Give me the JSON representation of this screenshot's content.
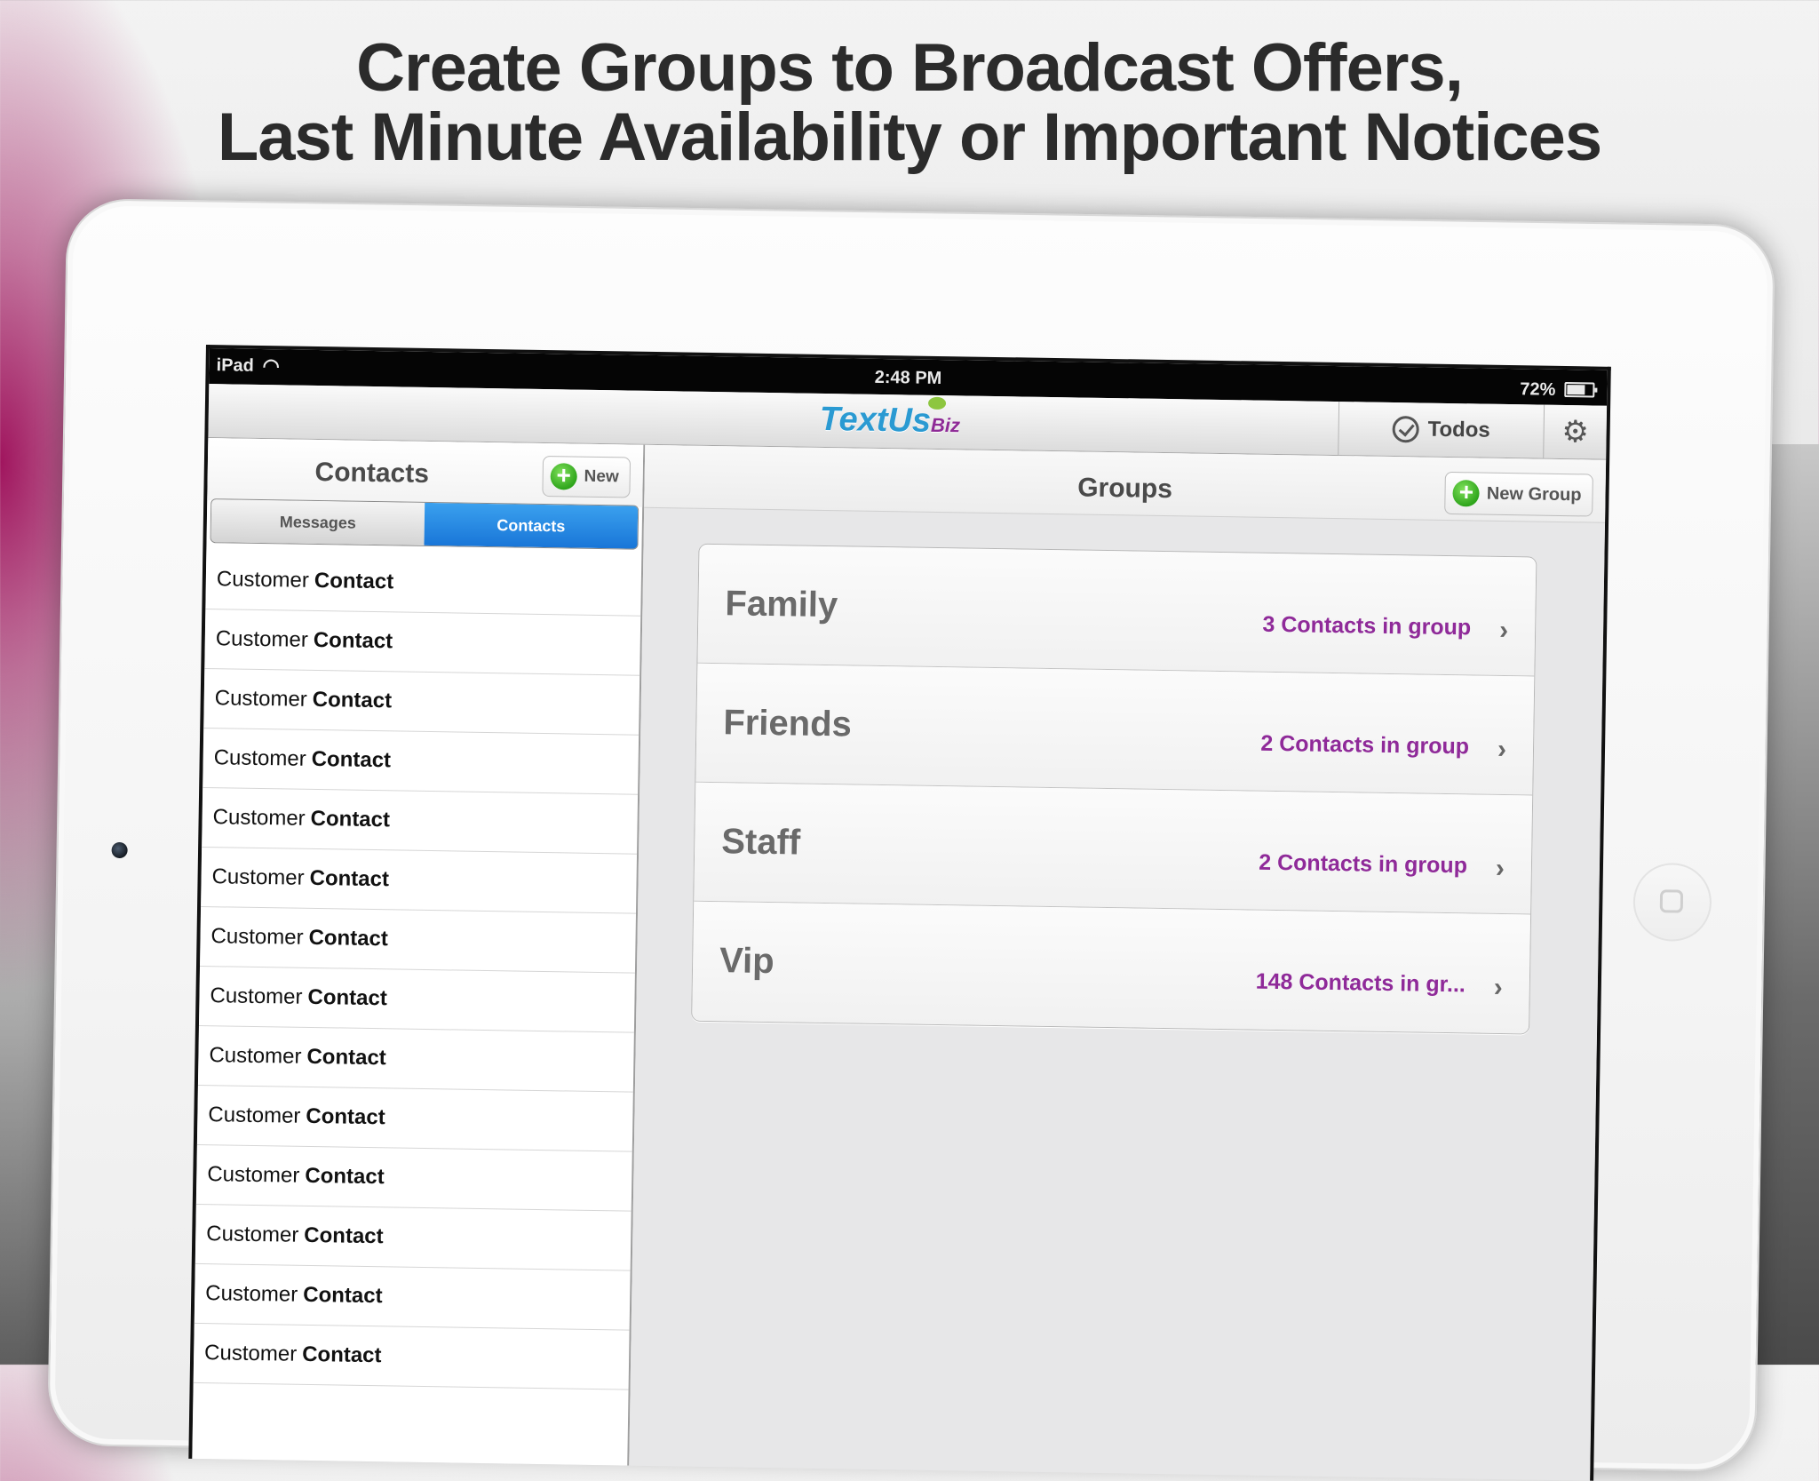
{
  "headline": {
    "line1": "Create Groups to Broadcast Offers,",
    "line2": "Last Minute Availability or Important Notices"
  },
  "status_bar": {
    "carrier": "iPad",
    "time": "2:48 PM",
    "battery": "72%"
  },
  "app": {
    "logo_text": "TextUs",
    "logo_suffix": "Biz",
    "todos_label": "Todos"
  },
  "sidebar": {
    "title": "Contacts",
    "new_label": "New",
    "segments": [
      "Messages",
      "Contacts"
    ],
    "selected_segment": "Contacts",
    "contacts": [
      {
        "first": "Customer",
        "last": "Contact"
      },
      {
        "first": "Customer",
        "last": "Contact"
      },
      {
        "first": "Customer",
        "last": "Contact"
      },
      {
        "first": "Customer",
        "last": "Contact"
      },
      {
        "first": "Customer",
        "last": "Contact"
      },
      {
        "first": "Customer",
        "last": "Contact"
      },
      {
        "first": "Customer",
        "last": "Contact"
      },
      {
        "first": "Customer",
        "last": "Contact"
      },
      {
        "first": "Customer",
        "last": "Contact"
      },
      {
        "first": "Customer",
        "last": "Contact"
      },
      {
        "first": "Customer",
        "last": "Contact"
      },
      {
        "first": "Customer",
        "last": "Contact"
      },
      {
        "first": "Customer",
        "last": "Contact"
      },
      {
        "first": "Customer",
        "last": "Contact"
      }
    ]
  },
  "main": {
    "title": "Groups",
    "new_group_label": "New Group",
    "groups": [
      {
        "name": "Family",
        "count": "3 Contacts in group"
      },
      {
        "name": "Friends",
        "count": "2 Contacts in group"
      },
      {
        "name": "Staff",
        "count": "2 Contacts in group"
      },
      {
        "name": "Vip",
        "count": "148 Contacts in gr..."
      }
    ]
  },
  "colors": {
    "accent_blue": "#1976d8",
    "group_count_purple": "#8f2a99",
    "logo_blue": "#2a9ad2",
    "add_green": "#2fa51c"
  },
  "icons": {
    "wifi": "wifi-icon",
    "battery": "battery-icon",
    "todos": "check-circle-icon",
    "settings": "gear-icon",
    "add": "plus-icon",
    "row_disclosure": "chevron-right-icon"
  }
}
